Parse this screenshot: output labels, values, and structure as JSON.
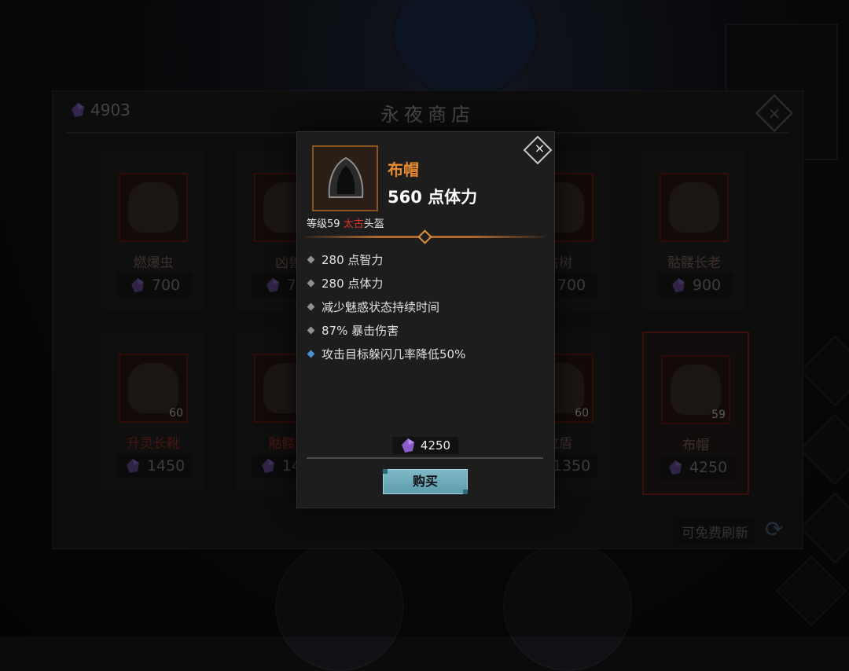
{
  "currency": {
    "amount": "4903",
    "icon": "gem-icon"
  },
  "shop": {
    "title": "永夜商店",
    "close_label": "×",
    "refresh_label": "可免费刷新",
    "items": [
      {
        "name": "燃爆虫",
        "price": "700",
        "level": "",
        "selected": false
      },
      {
        "name": "凶兽",
        "price": "700",
        "level": "",
        "selected": false
      },
      {
        "name": "",
        "price": "",
        "level": "",
        "selected": false
      },
      {
        "name": "古树",
        "price": "700",
        "level": "",
        "selected": false
      },
      {
        "name": "骷髅长老",
        "price": "900",
        "level": "",
        "selected": false
      },
      {
        "name": "升灵长靴",
        "price": "1450",
        "level": "60",
        "selected": false
      },
      {
        "name": "骷髅祭",
        "price": "1450",
        "level": "",
        "selected": false
      },
      {
        "name": "",
        "price": "",
        "level": "",
        "selected": false
      },
      {
        "name": "纹盾",
        "price": "1350",
        "level": "60",
        "selected": false
      },
      {
        "name": "布帽",
        "price": "4250",
        "level": "59",
        "selected": true
      }
    ]
  },
  "modal": {
    "item_name": "布帽",
    "main_stat": "560 点体力",
    "level_prefix": "等级59",
    "rarity": "太古",
    "slot": "头盔",
    "close_label": "×",
    "attributes": [
      {
        "text": "280 点智力",
        "type": "normal"
      },
      {
        "text": "280 点体力",
        "type": "normal"
      },
      {
        "text": "减少魅惑状态持续时间",
        "type": "normal"
      },
      {
        "text": "87% 暴击伤害",
        "type": "normal"
      },
      {
        "text": "攻击目标躲闪几率降低50%",
        "type": "legendary"
      }
    ],
    "price": "4250",
    "buy_label": "购买"
  },
  "colors": {
    "item_name": "#e58a2e",
    "rarity": "#e0362b",
    "legendary_bullet": "#4b8fd6",
    "buy_button": "#6fabb9",
    "gem": "#8a5cc9"
  }
}
